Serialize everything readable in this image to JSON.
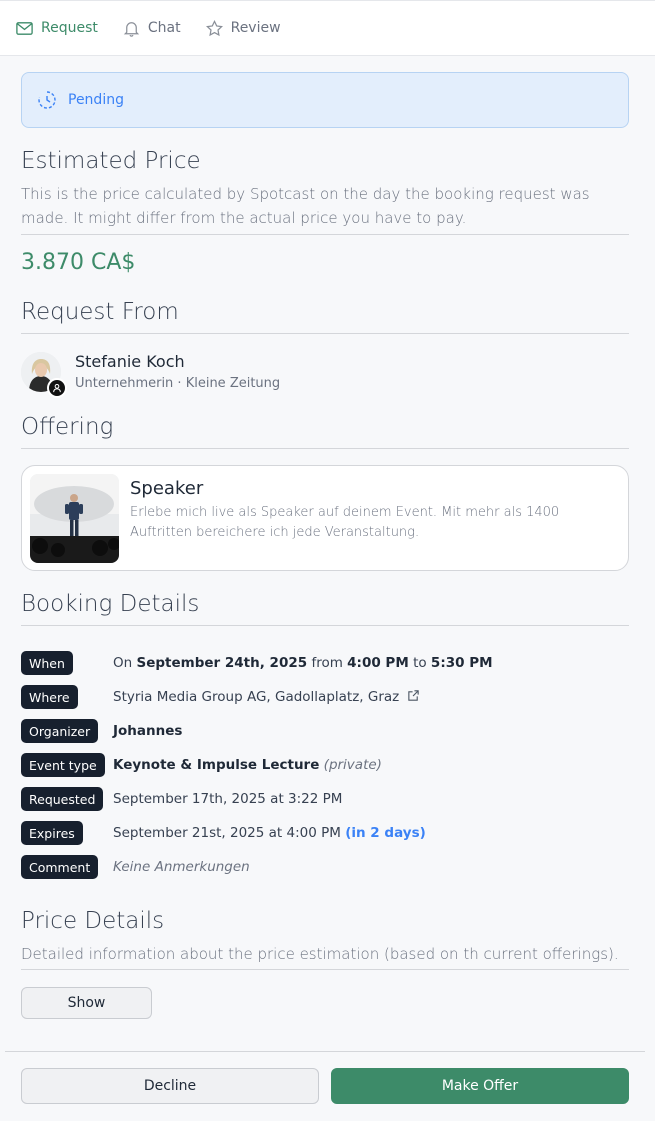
{
  "tabs": [
    {
      "label": "Request",
      "icon": "envelope-icon",
      "active": true
    },
    {
      "label": "Chat",
      "icon": "bell-icon",
      "active": false
    },
    {
      "label": "Review",
      "icon": "star-icon",
      "active": false
    }
  ],
  "status": {
    "label": "Pending",
    "icon": "clock-dashed-icon"
  },
  "estimated_price": {
    "title": "Estimated Price",
    "description": "This is the price calculated by Spotcast on the day the booking request was made. It might differ from the actual price you have to pay.",
    "value": "3.870 CA$"
  },
  "request_from": {
    "title": "Request From",
    "name": "Stefanie Koch",
    "subtitle": "Unternehmerin · Kleine Zeitung"
  },
  "offering": {
    "title": "Offering",
    "card_title": "Speaker",
    "card_description": "Erlebe mich live als Speaker auf deinem Event. Mit mehr als 1400 Auftritten bereichere ich jede Veranstaltung."
  },
  "booking_details": {
    "title": "Booking Details",
    "when": {
      "tag": "When",
      "prefix": "On",
      "date": "September 24th, 2025",
      "from_word": "from",
      "start": "4:00 PM",
      "to_word": "to",
      "end": "5:30 PM"
    },
    "where": {
      "tag": "Where",
      "value": "Styria Media Group AG, Gadollaplatz, Graz"
    },
    "organizer": {
      "tag": "Organizer",
      "value": "Johannes"
    },
    "event_type": {
      "tag": "Event type",
      "value": "Keynote & Impulse Lecture",
      "note": "(private)"
    },
    "requested": {
      "tag": "Requested",
      "value": "September 17th, 2025 at 3:22 PM"
    },
    "expires": {
      "tag": "Expires",
      "value": "September 21st, 2025 at 4:00 PM",
      "note": "(in 2 days)"
    },
    "comment": {
      "tag": "Comment",
      "value": "Keine Anmerkungen"
    }
  },
  "price_details": {
    "title": "Price Details",
    "description": "Detailed information about the price estimation (based on th current offerings).",
    "show_label": "Show"
  },
  "actions": {
    "decline": "Decline",
    "make_offer": "Make Offer"
  },
  "colors": {
    "accent": "#3d8b69",
    "pending": "#3b82f6",
    "tag_bg": "#17202e"
  }
}
